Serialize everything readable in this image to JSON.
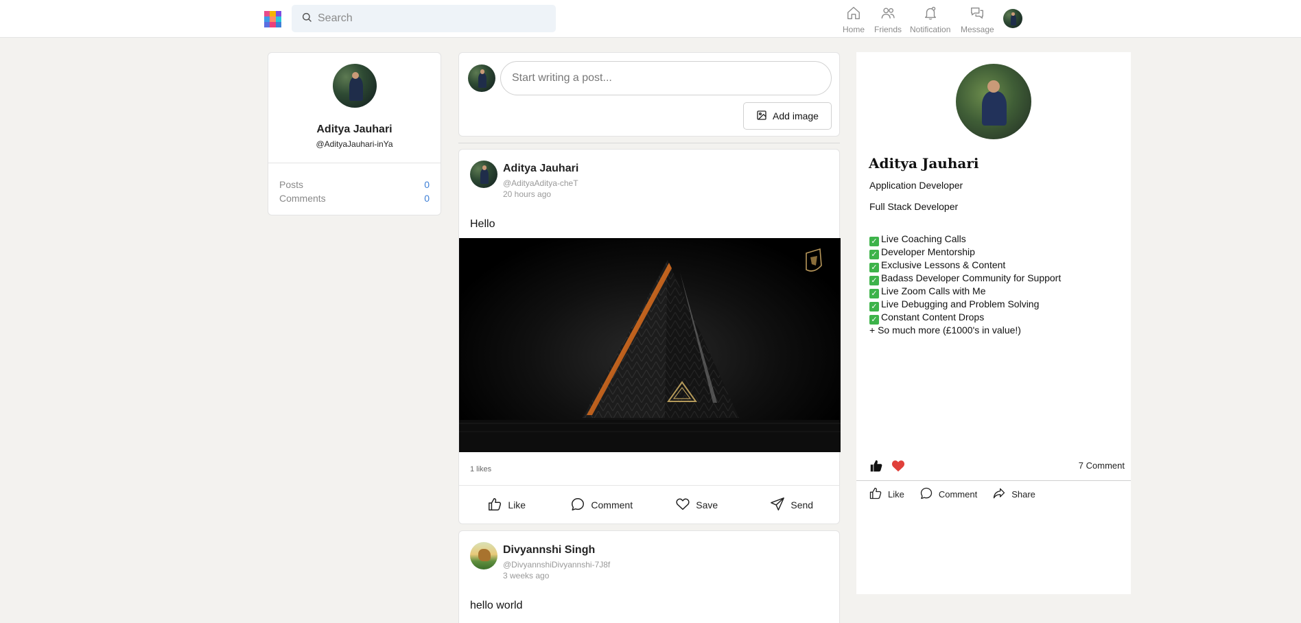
{
  "header": {
    "search_placeholder": "Search",
    "nav": {
      "home": "Home",
      "friends": "Friends",
      "notification": "Notification",
      "message": "Message"
    }
  },
  "profile": {
    "name": "Aditya Jauhari",
    "handle": "@AdityaJauhari-inYa",
    "posts_label": "Posts",
    "posts_count": "0",
    "comments_label": "Comments",
    "comments_count": "0"
  },
  "composer": {
    "placeholder": "Start writing a post...",
    "add_image_label": "Add image"
  },
  "posts": [
    {
      "author": "Aditya Jauhari",
      "handle": "@AdityaAditya-cheT",
      "time": "20 hours ago",
      "text": "Hello",
      "likes": "1 likes",
      "actions": {
        "like": "Like",
        "comment": "Comment",
        "save": "Save",
        "send": "Send"
      }
    },
    {
      "author": "Divyannshi Singh",
      "handle": "@DivyannshiDivyannshi-7J8f",
      "time": "3 weeks ago",
      "text": "hello world"
    }
  ],
  "featured": {
    "name": "Aditya Jauhari",
    "title1": "Application Developer",
    "title2": "Full Stack Developer",
    "list": [
      "Live Coaching Calls",
      "Developer Mentorship",
      "Exclusive Lessons & Content",
      "Badass Developer Community for Support",
      "Live Zoom Calls with Me",
      "Live Debugging and Problem Solving",
      "Constant Content Drops"
    ],
    "extra": "+ So much more (£1000's in value!)",
    "comments": "7 Comment",
    "actions": {
      "like": "Like",
      "comment": "Comment",
      "share": "Share"
    }
  },
  "colors": {
    "background": "#f3f2ef",
    "accent_blue": "#3d7fd6",
    "heart_red": "#e0403a",
    "check_green": "#3db34a"
  },
  "icons": [
    "app-logo",
    "search-icon",
    "home-icon",
    "friends-icon",
    "notification-icon",
    "message-icon",
    "image-icon",
    "thumbs-up-icon",
    "comment-icon",
    "heart-icon",
    "send-icon",
    "share-icon",
    "check-icon"
  ]
}
